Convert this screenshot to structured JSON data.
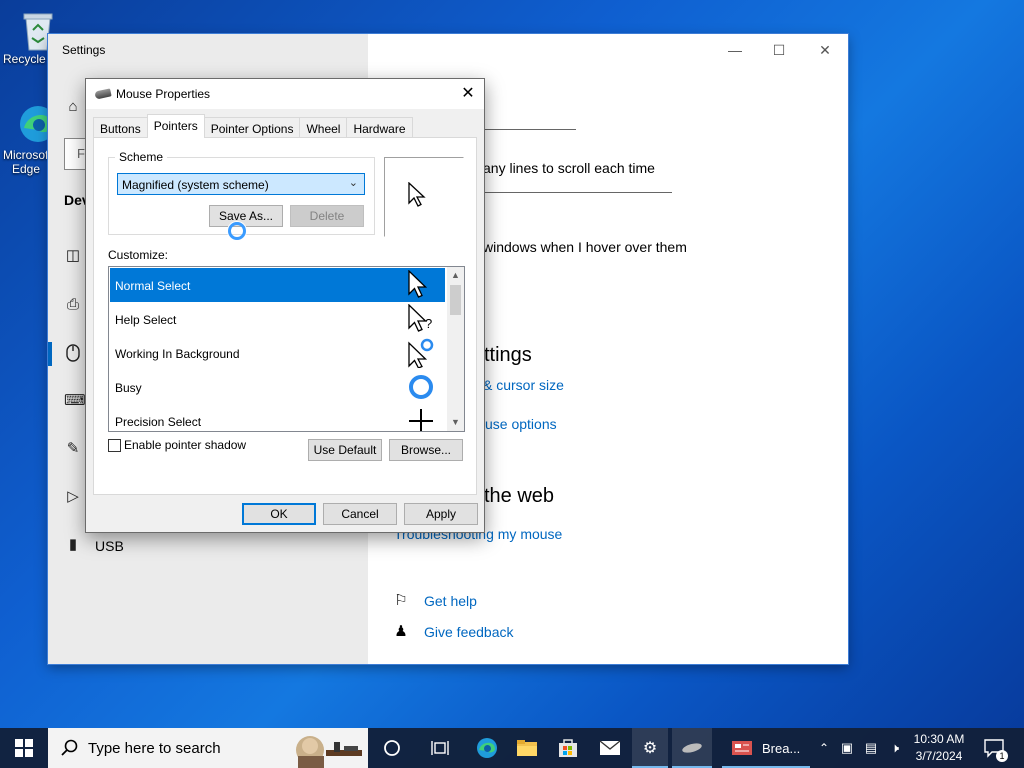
{
  "desktop": {
    "icons": [
      {
        "label": "Recycle Bin",
        "icon": "recycle-bin-icon"
      },
      {
        "label": "Microsoft Edge",
        "icon": "edge-icon"
      }
    ]
  },
  "settings": {
    "title": "Settings",
    "search_stub": "Fi",
    "section_stub": "Dev",
    "sidebar_label": "USB",
    "right": {
      "scroll_lines_text": "any lines to scroll each time",
      "hover_text": "windows when I hover over them",
      "related_heading": "ttings",
      "link_cursor": "& cursor size",
      "link_mouse": "use options",
      "help_heading": "the web",
      "link_troubleshoot": "Troubleshooting my mouse",
      "get_help": "Get help",
      "give_feedback": "Give feedback"
    }
  },
  "dialog": {
    "title": "Mouse Properties",
    "tabs": [
      "Buttons",
      "Pointers",
      "Pointer Options",
      "Wheel",
      "Hardware"
    ],
    "active_tab": "Pointers",
    "scheme_label": "Scheme",
    "scheme_value": "Magnified (system scheme)",
    "save_as": "Save As...",
    "delete": "Delete",
    "customize_label": "Customize:",
    "pointers": [
      {
        "label": "Normal Select",
        "selected": true,
        "cursor": "arrow"
      },
      {
        "label": "Help Select",
        "selected": false,
        "cursor": "help"
      },
      {
        "label": "Working In Background",
        "selected": false,
        "cursor": "working"
      },
      {
        "label": "Busy",
        "selected": false,
        "cursor": "busy"
      },
      {
        "label": "Precision Select",
        "selected": false,
        "cursor": "cross"
      }
    ],
    "shadow_label": "Enable pointer shadow",
    "shadow_checked": false,
    "use_default": "Use Default",
    "browse": "Browse...",
    "ok": "OK",
    "cancel": "Cancel",
    "apply": "Apply"
  },
  "taskbar": {
    "search_placeholder": "Type here to search",
    "app_label": "Brea...",
    "time": "10:30 AM",
    "date": "3/7/2024",
    "notifications": "1"
  },
  "colors": {
    "accent": "#0078d7",
    "link": "#0067c0"
  }
}
